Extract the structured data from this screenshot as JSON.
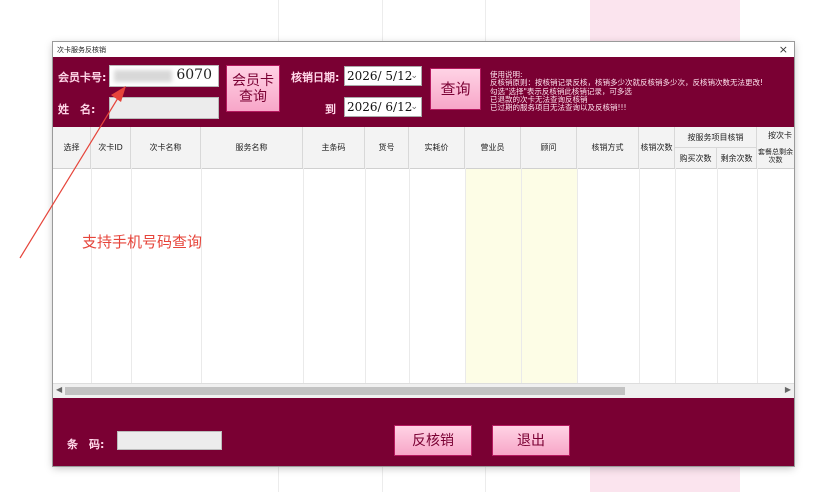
{
  "window": {
    "title": "次卡服务反核销",
    "close_glyph": "×"
  },
  "member": {
    "card_label": "会员卡号:",
    "card_value": "6070",
    "name_label": "姓　名:",
    "name_value": ""
  },
  "buttons": {
    "member_card_query": "会员卡\n查询",
    "query": "查询",
    "reverse": "反核销",
    "exit": "退出"
  },
  "dates": {
    "range_label": "核销日期:",
    "from": "2026/ 5/12",
    "to_label": "到",
    "to": "2026/ 6/12"
  },
  "instructions": [
    "使用说明:",
    "反核销原则：按核销记录反核，核销多少次就反核销多少次，反核销次数无法更改!",
    "勾选\"选择\"表示反核销此核销记录，可多选",
    "已退款的次卡无法查询反核销",
    "已过期的服务项目无法查询以及反核销!!!"
  ],
  "table": {
    "columns": [
      "选择",
      "次卡ID",
      "次卡名称",
      "服务名称",
      "主条码",
      "货号",
      "实耗价",
      "营业员",
      "顾问",
      "核销方式",
      "核销次数"
    ],
    "group_service": "按服务项目核销",
    "buy_count": "购买次数",
    "remaining": "剩余次数",
    "group_card": "按次卡",
    "package_total": "套餐总剩余次数"
  },
  "footer": {
    "barcode_label": "条　码:",
    "barcode_value": ""
  },
  "annotation": "支持手机号码查询",
  "colors": {
    "brand": "#7a0033",
    "button_pink": "#f7a6c8",
    "annotation": "#e6443a"
  }
}
